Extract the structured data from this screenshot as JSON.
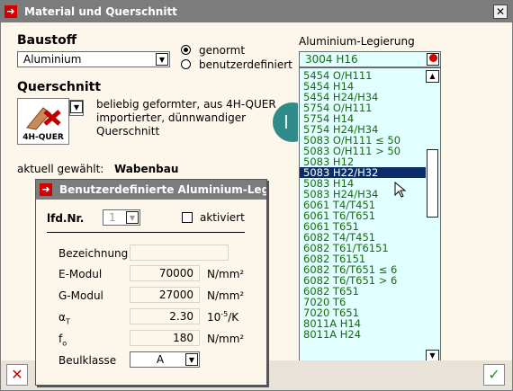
{
  "window": {
    "title": "Material und Querschnitt"
  },
  "baustoff": {
    "label": "Baustoff",
    "selected": "Aluminium",
    "radio_genormt": "genormt",
    "radio_benutzer": "benutzerdefiniert",
    "genormt_checked": true
  },
  "querschnitt": {
    "label": "Querschnitt",
    "icon_caption": "4H-QUER",
    "description_lines": [
      "beliebig geformter, aus 4H-QUER",
      "importierter, dünnwandiger",
      "Querschnitt"
    ],
    "current_label": "aktuell gewählt:",
    "current_value": "Wabenbau"
  },
  "legierung": {
    "label": "Aluminium-Legierung",
    "selected": "3004 H16",
    "items": [
      "5454 O/H111",
      "5454 H14",
      "5454 H24/H34",
      "5754 O/H111",
      "5754 H14",
      "5754 H24/H34",
      "5083 O/H111 ≤ 50",
      "5083 O/H111 > 50",
      "5083 H12",
      "5083 H22/H32",
      "5083 H14",
      "5083 H24/H34",
      "6061 T4/T451",
      "6061 T6/T651",
      "6061 T651",
      "6082 T4/T451",
      "6082 T61/T6151",
      "6082 T6151",
      "6082 T6/T651 ≤ 6",
      "6082 T6/T651 > 6",
      "6082 T651",
      "7020 T6",
      "7020 T651",
      "8011A H14",
      "8011A H24"
    ],
    "highlighted_index": 9
  },
  "dialog": {
    "title": "Benutzerdefinierte Aluminium-Leg...",
    "lfdnr_label": "lfd.Nr.",
    "lfdnr_value": "1",
    "aktiviert_label": "aktiviert",
    "bezeichnung_label": "Bezeichnung",
    "bezeichnung_value": "",
    "emodul_label": "E-Modul",
    "emodul_value": "70000",
    "emodul_unit": "N/mm²",
    "gmodul_label": "G-Modul",
    "gmodul_value": "27000",
    "gmodul_unit": "N/mm²",
    "alpha_label": "αT",
    "alpha_value": "2.30",
    "alpha_unit": "10-5/K",
    "fo_label": "fo",
    "fo_value": "180",
    "fo_unit": "N/mm²",
    "beulklasse_label": "Beulklasse",
    "beulklasse_value": "A"
  },
  "buttons": {
    "cancel": "✕",
    "ok": "✓"
  },
  "colors": {
    "accent": "#d40000",
    "list_bg": "#e0fffe",
    "list_text": "#1a6b10",
    "highlight": "#0a2d69"
  }
}
